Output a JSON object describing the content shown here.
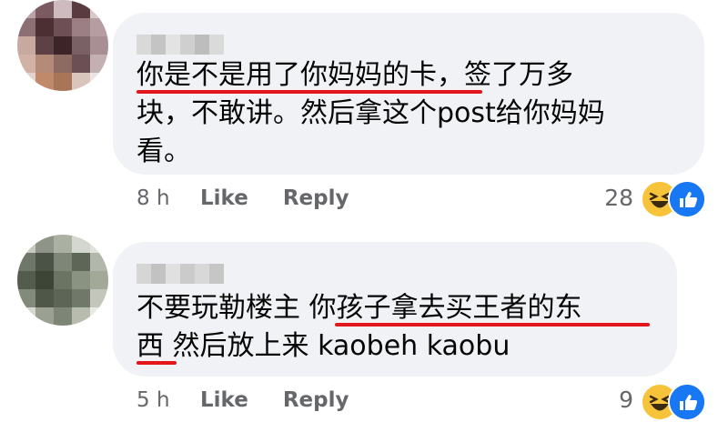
{
  "comments": [
    {
      "lines": [
        "你是不是用了你妈妈的卡，签了万多",
        "块，不敢讲。然后拿这个post给你妈妈",
        "看。"
      ],
      "time": "8 h",
      "like_label": "Like",
      "reply_label": "Reply",
      "reaction_count": "28",
      "reactions": [
        "haha-icon",
        "like-icon"
      ],
      "underline_color": "#e2161b"
    },
    {
      "lines": [
        "不要玩勒楼主 你孩子拿去买王者的东",
        "西 然后放上来 kaobeh kaobu"
      ],
      "time": "5 h",
      "like_label": "Like",
      "reply_label": "Reply",
      "reaction_count": "9",
      "reactions": [
        "haha-icon",
        "like-icon"
      ],
      "underline_color": "#e2161b"
    }
  ],
  "colors": {
    "bubble": "#f0f2f5",
    "meta_text": "#65676b",
    "haha": "#f7c33b",
    "like": "#1877f2"
  }
}
